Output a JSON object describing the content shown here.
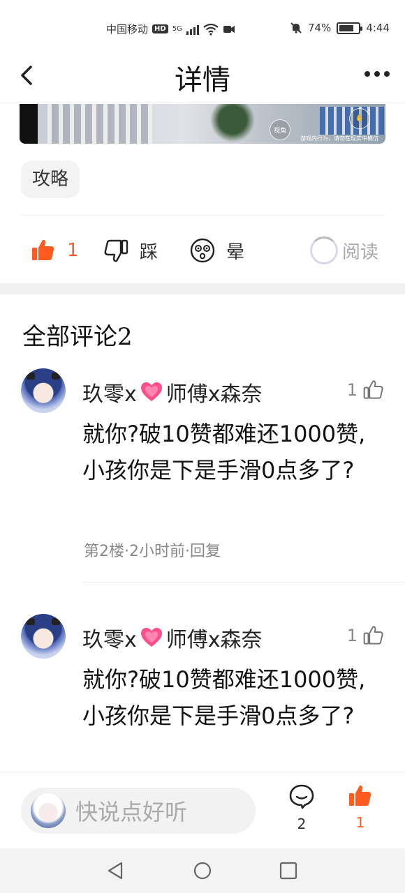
{
  "status_bar": {
    "carrier": "中国移动",
    "hd": "HD",
    "net": "5G",
    "battery": "74%",
    "battery_level": 0.74,
    "time": "4:44"
  },
  "header": {
    "title": "详情"
  },
  "video": {
    "btn_left": "视角",
    "tip": "游戏内行为，请勿在现实中模仿"
  },
  "tag": "攻略",
  "actions": {
    "like_count": "1",
    "dislike_label": "踩",
    "dizzy_label": "晕",
    "read_label": "阅读"
  },
  "comments_title": "全部评论2",
  "comments": [
    {
      "user_prefix": "玖零x",
      "user_suffix": "师傅x森奈",
      "likes": "1",
      "text": "就你?破10赞都难还1000赞,小孩你是下是手滑0点多了?",
      "meta": "第2楼·2小时前·回复"
    },
    {
      "user_prefix": "玖零x",
      "user_suffix": "师傅x森奈",
      "likes": "1",
      "text": "就你?破10赞都难还1000赞,小孩你是下是手滑0点多了?"
    }
  ],
  "bottom_bar": {
    "input_placeholder": "快说点好听",
    "comment_count": "2",
    "like_count": "1"
  },
  "colors": {
    "accent": "#ff5a1f",
    "muted": "#888888",
    "heart": "#ff4f8b"
  }
}
